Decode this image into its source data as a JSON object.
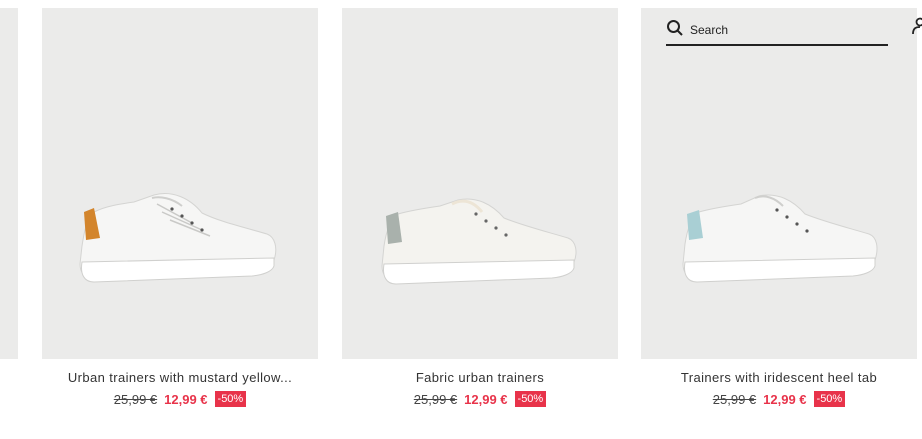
{
  "search": {
    "placeholder": "Search"
  },
  "products": [
    {
      "title": "Urban trainers with mustard yellow...",
      "old_price": "25,99 €",
      "new_price": "12,99 €",
      "discount": "-50%",
      "heel_color": "#d3852c"
    },
    {
      "title": "Fabric urban trainers",
      "old_price": "25,99 €",
      "new_price": "12,99 €",
      "discount": "-50%",
      "heel_color": "#a9b1ac"
    },
    {
      "title": "Trainers with iridescent heel tab",
      "old_price": "25,99 €",
      "new_price": "12,99 €",
      "discount": "-50%",
      "heel_color": "#a9cfd4"
    }
  ],
  "colors": {
    "tile_bg": "#ebebea",
    "sale_red": "#e8334a"
  }
}
